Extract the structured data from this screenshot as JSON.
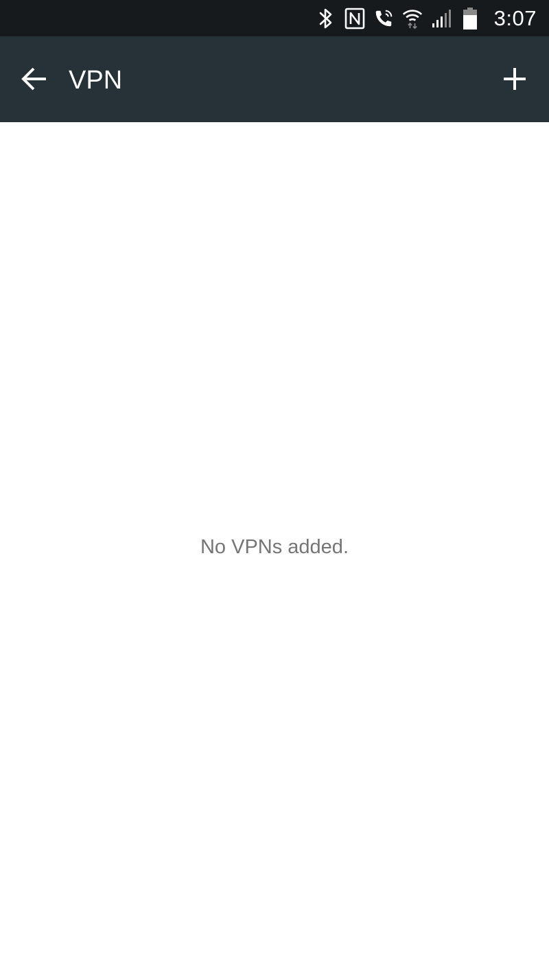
{
  "status_bar": {
    "time": "3:07",
    "icons": [
      "bluetooth-icon",
      "nfc-icon",
      "wifi-calling-icon",
      "wifi-icon",
      "cell-signal-icon",
      "battery-icon"
    ]
  },
  "app_bar": {
    "title": "VPN",
    "back_icon": "arrow-back-icon",
    "add_icon": "plus-icon"
  },
  "content": {
    "empty_message": "No VPNs added."
  },
  "colors": {
    "status_bar_bg": "#161a1d",
    "app_bar_bg": "#263238",
    "background": "#ffffff",
    "empty_text": "#757575"
  }
}
